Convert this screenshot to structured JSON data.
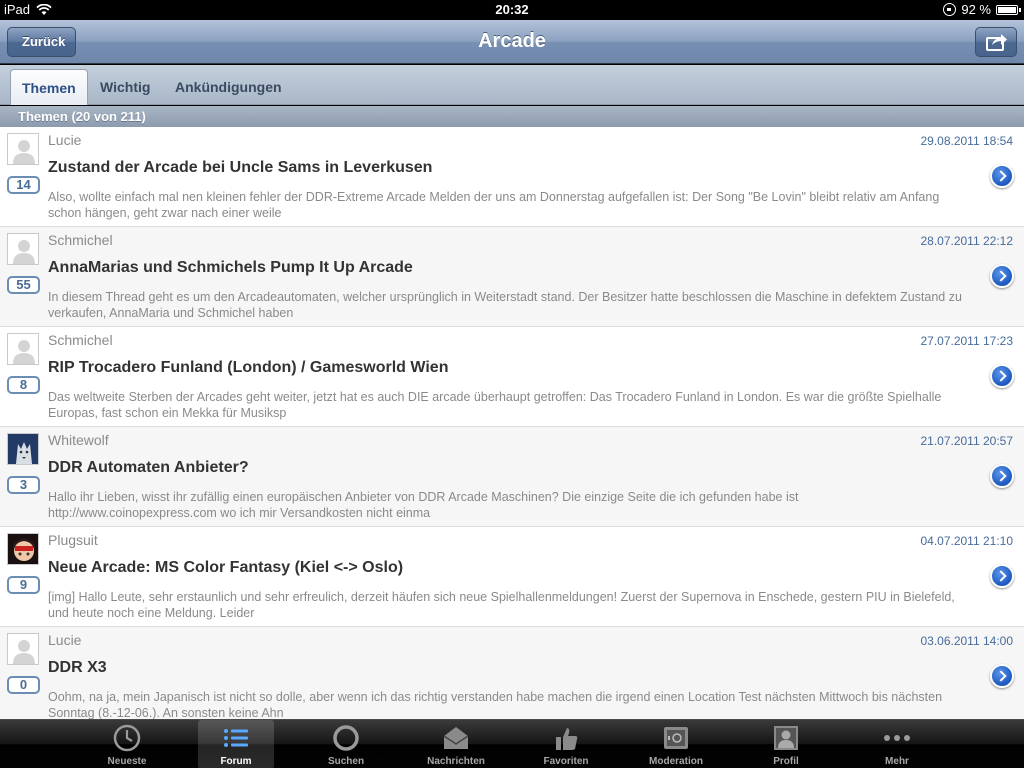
{
  "status": {
    "device": "iPad",
    "time": "20:32",
    "battery": "92 %"
  },
  "nav": {
    "back_label": "Zurück",
    "title": "Arcade"
  },
  "tabs": [
    {
      "label": "Themen",
      "active": true
    },
    {
      "label": "Wichtig",
      "active": false
    },
    {
      "label": "Ankündigungen",
      "active": false
    }
  ],
  "section": {
    "header": "Themen (20 von 211)"
  },
  "topics": [
    {
      "author": "Lucie",
      "date": "29.08.2011 18:54",
      "title": "Zustand der Arcade bei Uncle Sams in Leverkusen",
      "excerpt": "Also, wollte einfach mal nen kleinen fehler der DDR-Extreme Arcade Melden der uns am Donnerstag aufgefallen ist: Der Song \"Be Lovin\"  bleibt relativ am Anfang schon hängen, geht zwar nach einer weile",
      "replies": "14",
      "avatar": "default"
    },
    {
      "author": "Schmichel",
      "date": "28.07.2011 22:12",
      "title": "AnnaMarias und Schmichels Pump It Up Arcade",
      "excerpt": "In diesem Thread geht es um den Arcadeautomaten, welcher ursprünglich in Weiterstadt stand. Der Besitzer hatte beschlossen die Maschine in defektem Zustand zu verkaufen, AnnaMaria und Schmichel haben",
      "replies": "55",
      "avatar": "default"
    },
    {
      "author": "Schmichel",
      "date": "27.07.2011 17:23",
      "title": "RIP Trocadero Funland (London) / Gamesworld Wien",
      "excerpt": "Das weltweite Sterben der Arcades geht weiter, jetzt hat es auch DIE arcade überhaupt getroffen: Das Trocadero Funland in London. Es war die größte Spielhalle Europas, fast schon ein Mekka für Musiksp",
      "replies": "8",
      "avatar": "default"
    },
    {
      "author": "Whitewolf",
      "date": "21.07.2011 20:57",
      "title": "DDR Automaten Anbieter?",
      "excerpt": "Hallo ihr Lieben, wisst ihr zufällig einen europäischen Anbieter von DDR Arcade Maschinen? Die einzige Seite die ich gefunden habe ist http://www.coinopexpress.com wo ich mir Versandkosten nicht einma",
      "replies": "3",
      "avatar": "wolf"
    },
    {
      "author": "Plugsuit",
      "date": "04.07.2011 21:10",
      "title": "Neue Arcade: MS Color Fantasy (Kiel <-> Oslo)",
      "excerpt": "[img] Hallo Leute, sehr erstaunlich und sehr erfreulich, derzeit häufen sich neue Spielhallenmeldungen! Zuerst der Supernova in Enschede, gestern PIU in Bielefeld, und heute noch eine Meldung. Leider",
      "replies": "9",
      "avatar": "character"
    },
    {
      "author": "Lucie",
      "date": "03.06.2011 14:00",
      "title": "DDR X3",
      "excerpt": "Oohm, na ja, mein Japanisch ist nicht so dolle, aber wenn ich das richtig verstanden habe machen die irgend einen Location Test nächsten Mittwoch bis nächsten Sonntag (8.-12-06.). An sonsten keine Ahn",
      "replies": "0",
      "avatar": "default"
    }
  ],
  "tabbar": [
    {
      "label": "Neueste",
      "icon": "clock-icon",
      "active": false
    },
    {
      "label": "Forum",
      "icon": "list-icon",
      "active": true
    },
    {
      "label": "Suchen",
      "icon": "magnifier-icon",
      "active": false
    },
    {
      "label": "Nachrichten",
      "icon": "envelope-icon",
      "active": false
    },
    {
      "label": "Favoriten",
      "icon": "thumbs-up-icon",
      "active": false
    },
    {
      "label": "Moderation",
      "icon": "safe-icon",
      "active": false
    },
    {
      "label": "Profil",
      "icon": "profile-icon",
      "active": false
    },
    {
      "label": "Mehr",
      "icon": "more-dots-icon",
      "active": false
    }
  ]
}
